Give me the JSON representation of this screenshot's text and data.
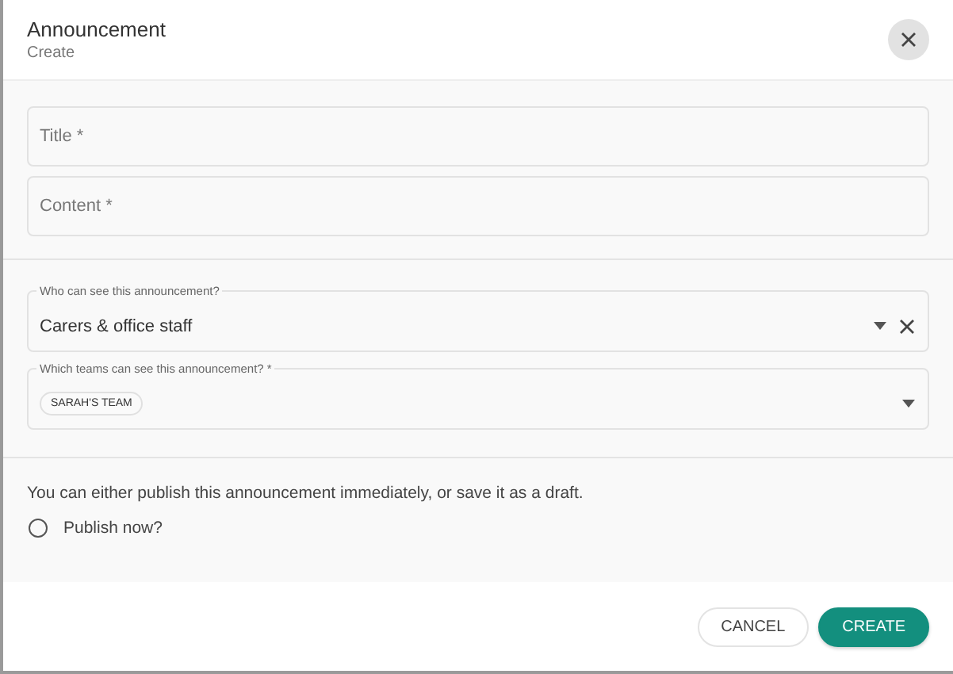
{
  "dialog": {
    "title": "Announcement",
    "subtitle": "Create"
  },
  "fields": [
    {
      "placeholder": "Title *"
    },
    {
      "placeholder": "Content *"
    }
  ],
  "selects": [
    {
      "kind": "single",
      "label": "Who can see this announcement?",
      "value": "Carers & office staff",
      "clearable": true
    },
    {
      "kind": "multi",
      "label": "Which teams can see this announcement? *",
      "chips": [
        "SARAH'S TEAM"
      ],
      "clearable": false
    }
  ],
  "publish": {
    "note": "You can either publish this announcement immediately, or save it as a draft.",
    "option": {
      "label": "Publish now?",
      "selected": false
    }
  },
  "buttons": [
    {
      "kind": "secondary",
      "label": "CANCEL"
    },
    {
      "kind": "primary",
      "label": "CREATE"
    }
  ]
}
